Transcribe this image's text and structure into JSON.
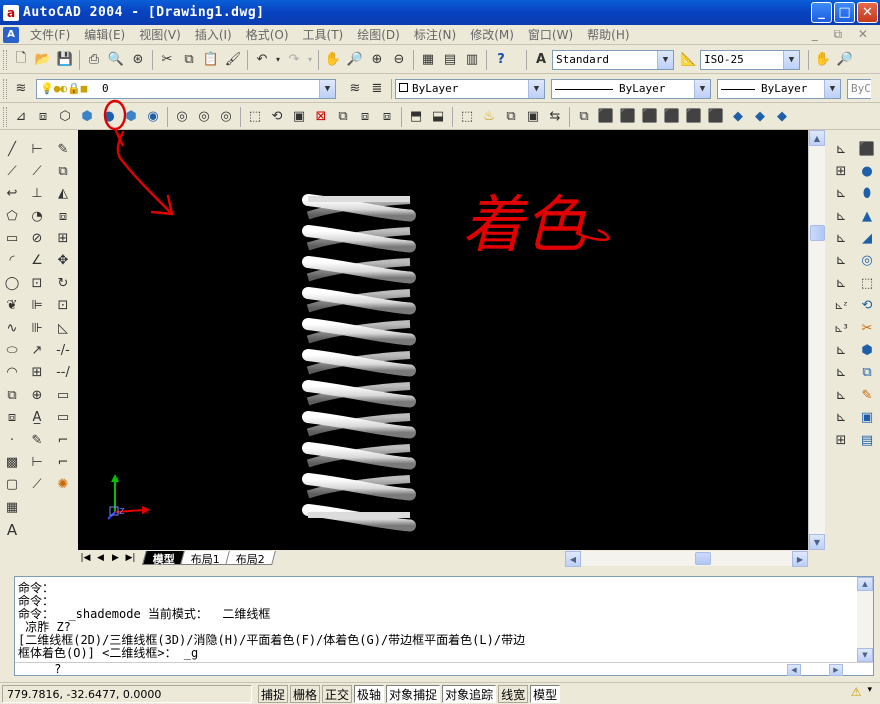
{
  "window": {
    "title": "AutoCAD 2004 - [Drawing1.dwg]",
    "app_icon": "a",
    "min": "_",
    "max": "□",
    "close": "✕"
  },
  "menu": {
    "items": [
      "文件(F)",
      "编辑(E)",
      "视图(V)",
      "插入(I)",
      "格式(O)",
      "工具(T)",
      "绘图(D)",
      "标注(N)",
      "修改(M)",
      "窗口(W)",
      "帮助(H)"
    ],
    "right_controls": "_ ⧉ ✕"
  },
  "standard_toolbar": {
    "text_style": "Standard",
    "dim_style": "ISO-25"
  },
  "layer_toolbar": {
    "layer_name": "0",
    "color": "ByLayer",
    "linetype": "ByLayer",
    "lineweight": "ByLayer",
    "plotstyle": "ByC"
  },
  "drawing": {
    "annotation_text": "着色",
    "ucs": {
      "x": "X",
      "y": "Y",
      "z": "Z"
    }
  },
  "layout_tabs": [
    "模型",
    "布局1",
    "布局2"
  ],
  "command_area": {
    "lines": [
      "命令：",
      "命令：",
      "命令：  _shademode 当前模式：  二维线框",
      " 凉胙 Z?",
      "[二维线框(2D)/三维线框(3D)/消隐(H)/平面着色(F)/体着色(G)/带边框平面着色(L)/带边",
      "框体着色(O)] <二维线框>： _g"
    ],
    "input_line": "     ?"
  },
  "status": {
    "coords": "779.7816,  -32.6477,  0.0000",
    "buttons": [
      "捕捉",
      "栅格",
      "正交",
      "极轴",
      "对象捕捉",
      "对象追踪",
      "线宽",
      "模型"
    ]
  },
  "colors": {
    "annotation": "#e00000",
    "spring": "#e8e8e8"
  }
}
